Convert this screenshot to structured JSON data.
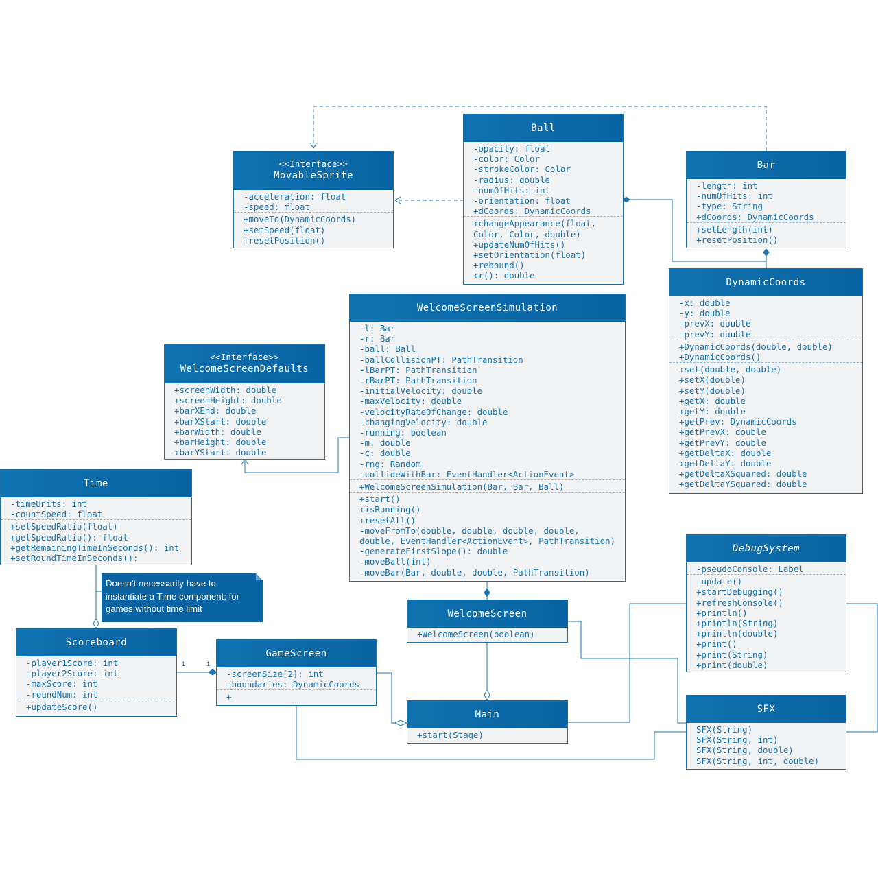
{
  "classes": {
    "ball": {
      "title": "Ball",
      "attributes": [
        "-opacity: float",
        "-color: Color",
        "-strokeColor: Color",
        "-radius: double",
        "-numOfHits: int",
        "-orientation: float",
        "+dCoords: DynamicCoords"
      ],
      "methods": [
        "+changeAppearance(float,",
        "Color, Color, double)",
        "+updateNumOfHits()",
        "+setOrientation(float)",
        "+rebound()",
        "+r(): double"
      ]
    },
    "movable_sprite": {
      "stereotype": "<<Interface>>",
      "title": "MovableSprite",
      "attributes": [
        "-acceleration: float",
        "-speed: float"
      ],
      "methods": [
        "+moveTo(DynamicCoords)",
        "+setSpeed(float)",
        "+resetPosition()"
      ]
    },
    "bar": {
      "title": "Bar",
      "attributes": [
        "-length: int",
        "-numOfHits: int",
        "-type: String",
        "+dCoords: DynamicCoords"
      ],
      "methods": [
        "+setLength(int)",
        "+resetPosition()"
      ]
    },
    "dynamic_coords": {
      "title": "DynamicCoords",
      "attributes": [
        "-x: double",
        "-y: double",
        "-prevX: double",
        "-prevY: double"
      ],
      "constructors": [
        "+DynamicCoords(double, double)",
        "+DynamicCoords()"
      ],
      "methods": [
        "+set(double, double)",
        "+setX(double)",
        "+setY(double)",
        "+getX: double",
        "+getY: double",
        "+getPrev: DynamicCoords",
        "+getPrevX: double",
        "+getPrevY: double",
        "+getDeltaX: double",
        "+getDeltaY: double",
        "+getDeltaXSquared: double",
        "+getDeltaYSquared: double"
      ]
    },
    "welcome_screen_simulation": {
      "title": "WelcomeScreenSimulation",
      "attributes": [
        "-l: Bar",
        "-r: Bar",
        "-ball: Ball",
        "-ballCollisionPT: PathTransition",
        "-lBarPT: PathTransition",
        "-rBarPT: PathTransition",
        "-initialVelocity: double",
        "-maxVelocity: double",
        "-velocityRateOfChange: double",
        "-changingVelocity: double",
        "-running: boolean",
        "-m: double",
        "-c: double",
        "-rng: Random",
        "-collideWithBar: EventHandler<ActionEvent>"
      ],
      "constructors": [
        "+WelcomeScreenSimulation(Bar, Bar, Ball)"
      ],
      "methods": [
        "+start()",
        "+isRunning()",
        "+resetAll()",
        "-moveFromTo(double, double, double, double,",
        "double, EventHandler<ActionEvent>, PathTransition)",
        "-generateFirstSlope(): double",
        "-moveBall(int)",
        "-moveBar(Bar, double, double, PathTransition)"
      ]
    },
    "welcome_screen_defaults": {
      "stereotype": "<<Interface>>",
      "title": "WelcomeScreenDefaults",
      "attributes": [
        "+screenWidth: double",
        "+screenHeight: double",
        "+barXEnd: double",
        "+barXStart: double",
        "+barWidth: double",
        "+barHeight: double",
        "+barYStart: double"
      ]
    },
    "time": {
      "title": "Time",
      "attributes": [
        "-timeUnits: int",
        "-countSpeed: float"
      ],
      "methods": [
        "+setSpeedRatio(float)",
        "+getSpeedRatio(): float",
        "+getRemainingTimeInSeconds(): int",
        "+setRoundTimeInSeconds():"
      ]
    },
    "scoreboard": {
      "title": "Scoreboard",
      "attributes": [
        "-player1Score: int",
        "-player2Score: int",
        "-maxScore: int",
        "-roundNum: int"
      ],
      "methods": [
        "+updateScore()"
      ]
    },
    "game_screen": {
      "title": "GameScreen",
      "attributes": [
        "-screenSize[2]: int",
        "-boundaries: DynamicCoords"
      ],
      "methods": [
        "+"
      ]
    },
    "welcome_screen": {
      "title": "WelcomeScreen",
      "methods": [
        "+WelcomeScreen(boolean)"
      ]
    },
    "main": {
      "title": "Main",
      "methods": [
        "+start(Stage)"
      ]
    },
    "debug_system": {
      "title": "DebugSystem",
      "attributes": [
        "-pseudoConsole: Label"
      ],
      "methods": [
        "-update()",
        "+startDebugging()",
        "+refreshConsole()",
        "+println()",
        "+println(String)",
        "+println(double)",
        "+print()",
        "+print(String)",
        "+print(double)"
      ]
    },
    "sfx": {
      "title": "SFX",
      "methods": [
        "SFX(String)",
        "SFX(String, int)",
        "SFX(String, double)",
        "SFX(String, int, double)"
      ]
    }
  },
  "note": {
    "text": "Doesn't necessarily have to instantiate a Time component; for games without time limit"
  },
  "multiplicities": {
    "scoreboard_end": "1",
    "game_screen_end": "1"
  },
  "colors": {
    "header": "#0a63a3",
    "line": "#1b75b0",
    "body": "#f1f2f3",
    "text": "#1b75b0"
  }
}
